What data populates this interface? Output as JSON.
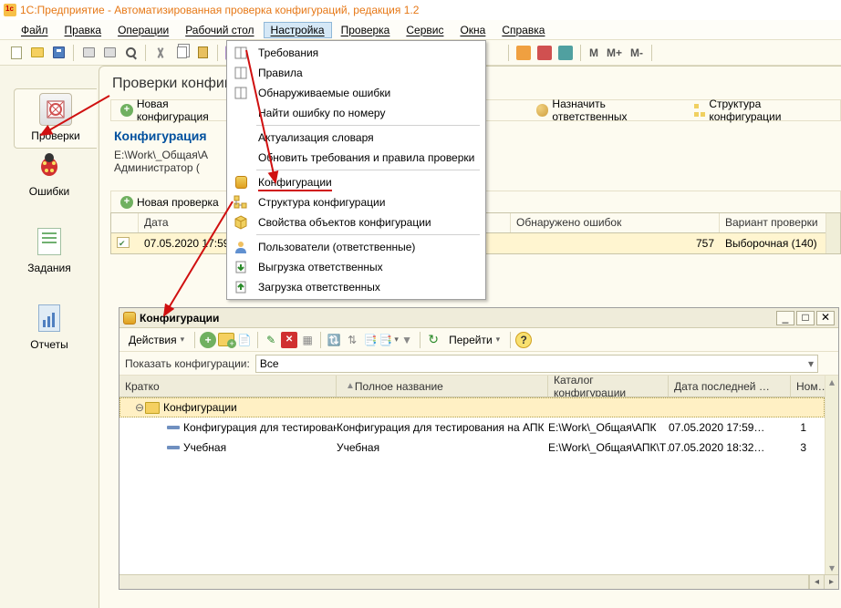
{
  "app_title": "1С:Предприятие - Автоматизированная проверка конфигураций, редакция 1.2",
  "menubar": [
    "Файл",
    "Правка",
    "Операции",
    "Рабочий стол",
    "Настройка",
    "Проверка",
    "Сервис",
    "Окна",
    "Справка"
  ],
  "menubar_active_index": 4,
  "toolbar_tail": {
    "m": "M",
    "mplus": "M+",
    "mminus": "M-"
  },
  "dropdown": {
    "items": [
      [
        "book",
        "Требования"
      ],
      [
        "book",
        "Правила"
      ],
      [
        "book",
        "Обнаруживаемые ошибки"
      ],
      [
        "",
        "Найти ошибку по номеру"
      ],
      [
        "",
        "Актуализация словаря"
      ],
      [
        "",
        "Обновить требования и правила проверки"
      ],
      [
        "cylinder",
        "Конфигурации"
      ],
      [
        "tree",
        "Структура конфигурации"
      ],
      [
        "cube",
        "Свойства объектов конфигурации"
      ],
      [
        "user",
        "Пользователи (ответственные)"
      ],
      [
        "export",
        "Выгрузка ответственных"
      ],
      [
        "import",
        "Загрузка ответственных"
      ]
    ],
    "separators_after": [
      3,
      5,
      8
    ],
    "highlight_index": 6
  },
  "sidebar": [
    {
      "label": "Проверки",
      "active": true
    },
    {
      "label": "Ошибки",
      "active": false
    },
    {
      "label": "Задания",
      "active": false
    },
    {
      "label": "Отчеты",
      "active": false
    }
  ],
  "page_title": "Проверки конфигураций",
  "panel1_actions": {
    "new_config": "Новая конфигурация",
    "assign": "Назначить ответственных",
    "struct": "Структура конфигурации"
  },
  "info": {
    "title": "Конфигурация",
    "path": "E:\\Work\\_Общая\\А",
    "user": "Администратор ("
  },
  "panel2_actions": {
    "new_check": "Новая проверка"
  },
  "checks_grid": {
    "headers": [
      "",
      "Дата",
      "Обнаружено ошибок",
      "Вариант проверки"
    ],
    "row": {
      "date": "07.05.2020 17:59:",
      "errors": "757",
      "variant": "Выборочная (140)"
    }
  },
  "cfg_window": {
    "title": "Конфигурации",
    "actions_label": "Действия",
    "goto_label": "Перейти",
    "filter_label": "Показать конфигурации:",
    "filter_value": "Все",
    "headers": [
      "Кратко",
      "Полное название",
      "Каталог конфигурации",
      "Дата последней …",
      "Ном…"
    ],
    "root": "Конфигурации",
    "rows": [
      {
        "short": "Конфигурация для тестирования",
        "full": "Конфигурация для тестирования на АПК",
        "path": "E:\\Work\\_Общая\\АПК",
        "date": "07.05.2020 17:59…",
        "num": "1"
      },
      {
        "short": "Учебная",
        "full": "Учебная",
        "path": "E:\\Work\\_Общая\\АПК\\Т…",
        "date": "07.05.2020 18:32…",
        "num": "3"
      }
    ]
  }
}
